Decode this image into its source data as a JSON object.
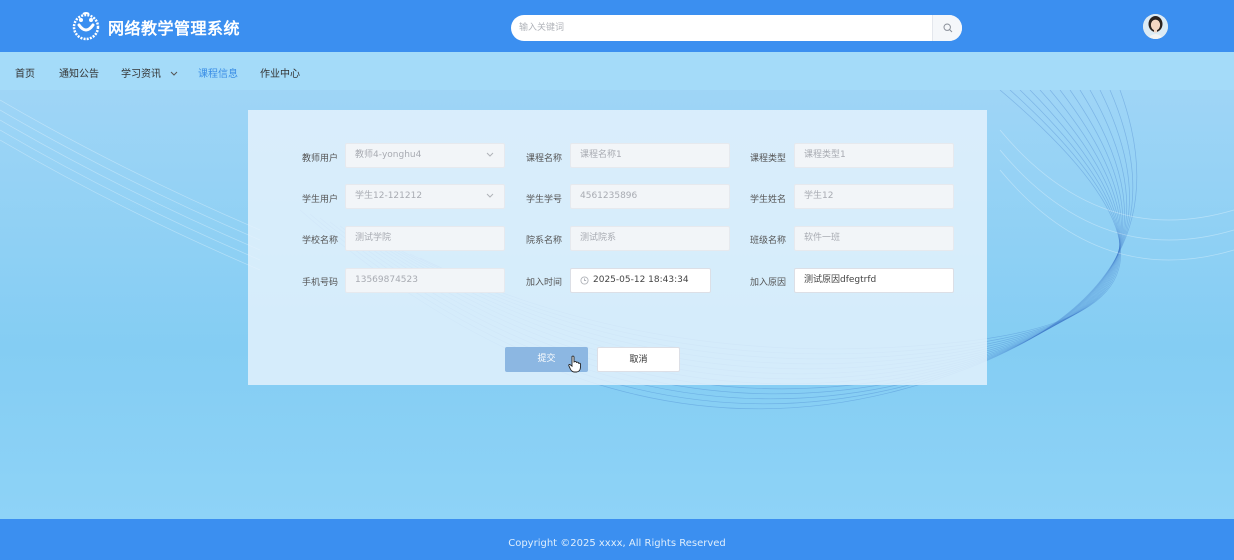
{
  "header": {
    "site_title": "网络教学管理系统",
    "logo_icon": "smile-logo-icon",
    "search_placeholder": "输入关键词",
    "search_icon": "search-icon",
    "avatar_icon": "user-avatar"
  },
  "nav": {
    "items": [
      {
        "label": "首页",
        "active": false
      },
      {
        "label": "通知公告",
        "active": false
      },
      {
        "label": "学习资讯",
        "active": false,
        "has_dropdown": true
      },
      {
        "label": "课程信息",
        "active": true
      },
      {
        "label": "作业中心",
        "active": false
      }
    ]
  },
  "form": {
    "teacher_user": {
      "label": "教师用户",
      "value": "教师4-yonghu4"
    },
    "course_name": {
      "label": "课程名称",
      "value": "课程名称1"
    },
    "course_type": {
      "label": "课程类型",
      "value": "课程类型1"
    },
    "student_user": {
      "label": "学生用户",
      "value": "学生12-121212"
    },
    "student_id": {
      "label": "学生学号",
      "value": "4561235896"
    },
    "student_name": {
      "label": "学生姓名",
      "value": "学生12"
    },
    "school_name": {
      "label": "学校名称",
      "value": "测试学院"
    },
    "department_name": {
      "label": "院系名称",
      "value": "测试院系"
    },
    "class_name": {
      "label": "班级名称",
      "value": "软件一班"
    },
    "phone": {
      "label": "手机号码",
      "value": "13569874523"
    },
    "join_time": {
      "label": "加入时间",
      "value": "2025-05-12 18:43:34"
    },
    "join_reason": {
      "label": "加入原因",
      "value": "测试原因dfegtrfd"
    },
    "submit_label": "提交",
    "cancel_label": "取消"
  },
  "footer": {
    "copyright": "Copyright ©2025 xxxx, All Rights Reserved"
  },
  "colors": {
    "header_bg": "#3b8ff0",
    "nav_bg": "#a4dbf9",
    "active_nav": "#3a8ee6",
    "submit_bg": "#8cb7e2"
  }
}
